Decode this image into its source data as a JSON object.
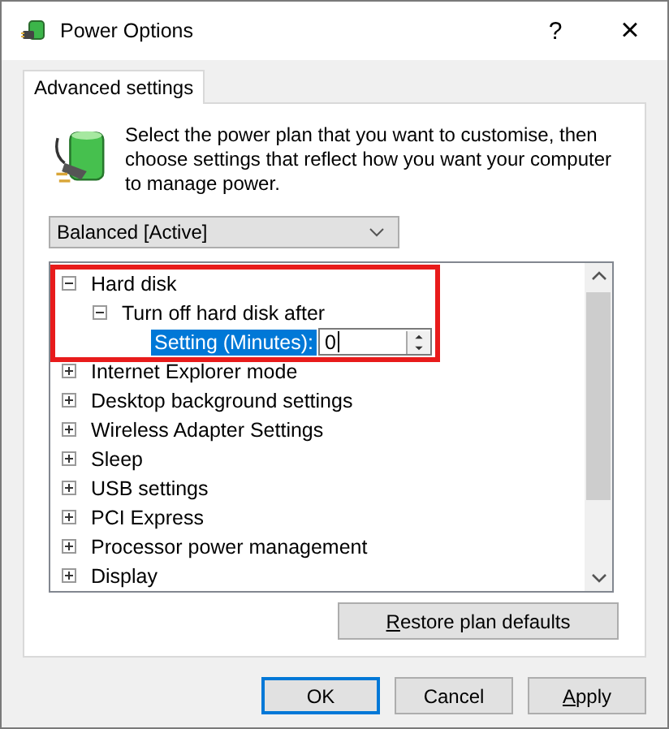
{
  "window": {
    "title": "Power Options",
    "help_glyph": "?",
    "close_glyph": "×"
  },
  "tabs": [
    {
      "label": "Advanced settings",
      "selected": true
    }
  ],
  "description": "Select the power plan that you want to customise, then choose settings that reflect how you want your computer to manage power.",
  "plan_dropdown": {
    "value": "Balanced [Active]"
  },
  "tree": [
    {
      "label": "Hard disk",
      "expanded": true,
      "highlighted": true,
      "children": [
        {
          "label": "Turn off hard disk after",
          "expanded": true,
          "setting": {
            "label": "Setting (Minutes):",
            "value": "0",
            "selected": true
          }
        }
      ]
    },
    {
      "label": "Internet Explorer mode",
      "expanded": false,
      "highlighted": false
    },
    {
      "label": "Desktop background settings",
      "expanded": false,
      "highlighted": false
    },
    {
      "label": "Wireless Adapter Settings",
      "expanded": false,
      "highlighted": false
    },
    {
      "label": "Sleep",
      "expanded": false,
      "highlighted": false
    },
    {
      "label": "USB settings",
      "expanded": false,
      "highlighted": false
    },
    {
      "label": "PCI Express",
      "expanded": false,
      "highlighted": false
    },
    {
      "label": "Processor power management",
      "expanded": false,
      "highlighted": false
    },
    {
      "label": "Display",
      "expanded": false,
      "highlighted": false
    }
  ],
  "restore_button": {
    "label": "Restore plan defaults",
    "underline_first": true
  },
  "buttons": [
    {
      "label": "OK",
      "default": true,
      "underline_first": false
    },
    {
      "label": "Cancel",
      "default": false,
      "underline_first": false
    },
    {
      "label": "Apply",
      "default": false,
      "underline_first": true
    }
  ]
}
